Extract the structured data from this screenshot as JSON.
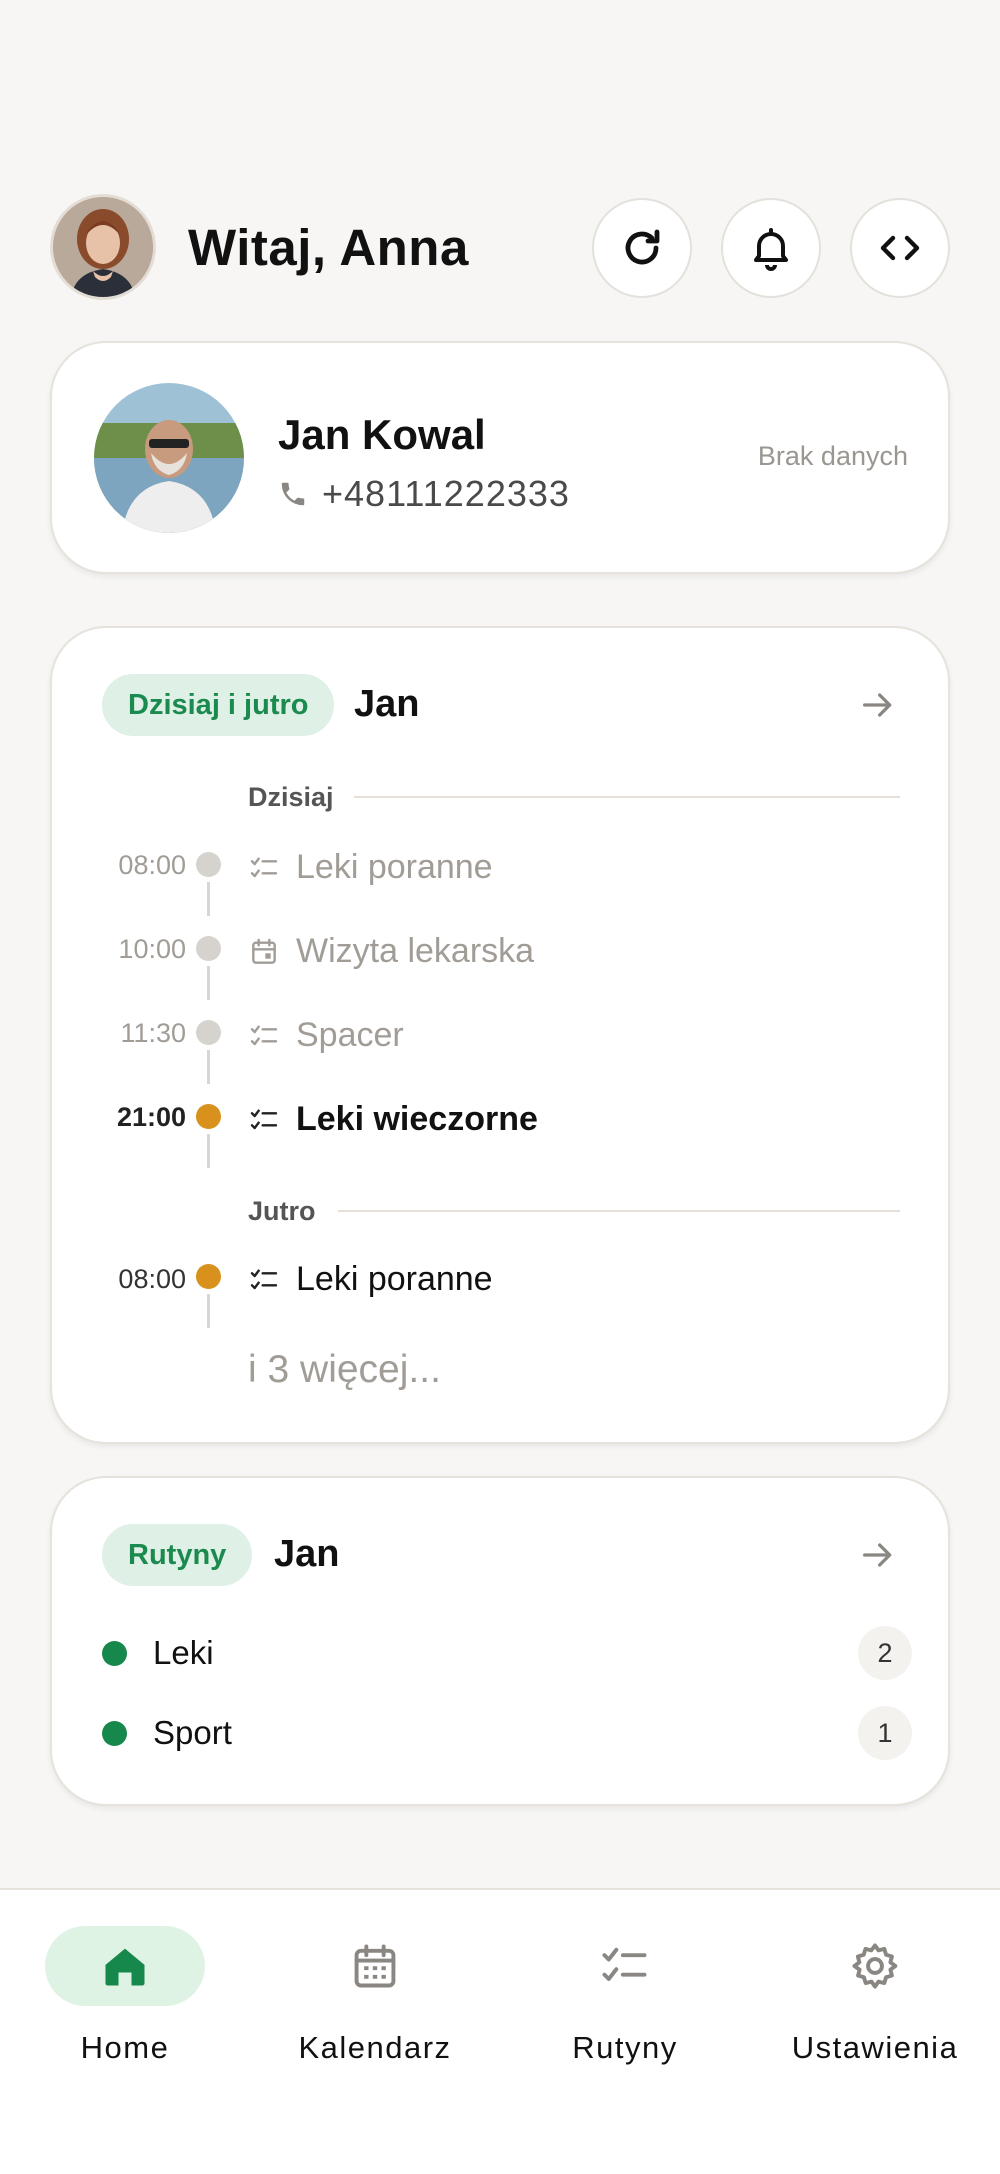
{
  "header": {
    "greeting": "Witaj, Anna",
    "buttons": [
      "refresh-icon",
      "bell-icon",
      "code-icon"
    ]
  },
  "contact": {
    "name": "Jan Kowal",
    "phone": "+48111222333",
    "status": "Brak danych"
  },
  "schedule": {
    "pill": "Dzisiaj i jutro",
    "owner": "Jan",
    "today_label": "Dzisiaj",
    "tomorrow_label": "Jutro",
    "today": [
      {
        "time": "08:00",
        "title": "Leki poranne",
        "icon": "checklist-icon",
        "active": false
      },
      {
        "time": "10:00",
        "title": "Wizyta lekarska",
        "icon": "calendar-icon",
        "active": false
      },
      {
        "time": "11:30",
        "title": "Spacer",
        "icon": "checklist-icon",
        "active": false
      },
      {
        "time": "21:00",
        "title": "Leki wieczorne",
        "icon": "checklist-icon",
        "active": true
      }
    ],
    "tomorrow": [
      {
        "time": "08:00",
        "title": "Leki poranne",
        "icon": "checklist-icon",
        "active": true
      }
    ],
    "more": "i 3 więcej..."
  },
  "routines": {
    "pill": "Rutyny",
    "owner": "Jan",
    "items": [
      {
        "label": "Leki",
        "count": "2"
      },
      {
        "label": "Sport",
        "count": "1"
      }
    ]
  },
  "nav": {
    "items": [
      {
        "label": "Home",
        "icon": "home-icon",
        "active": true
      },
      {
        "label": "Kalendarz",
        "icon": "calendar-icon",
        "active": false
      },
      {
        "label": "Rutyny",
        "icon": "checklist-icon",
        "active": false
      },
      {
        "label": "Ustawienia",
        "icon": "gear-icon",
        "active": false
      }
    ]
  },
  "colors": {
    "accent_green": "#16884c",
    "pill_bg": "#dff0e6",
    "active_dot": "#d8911c",
    "background": "#f7f6f4"
  }
}
